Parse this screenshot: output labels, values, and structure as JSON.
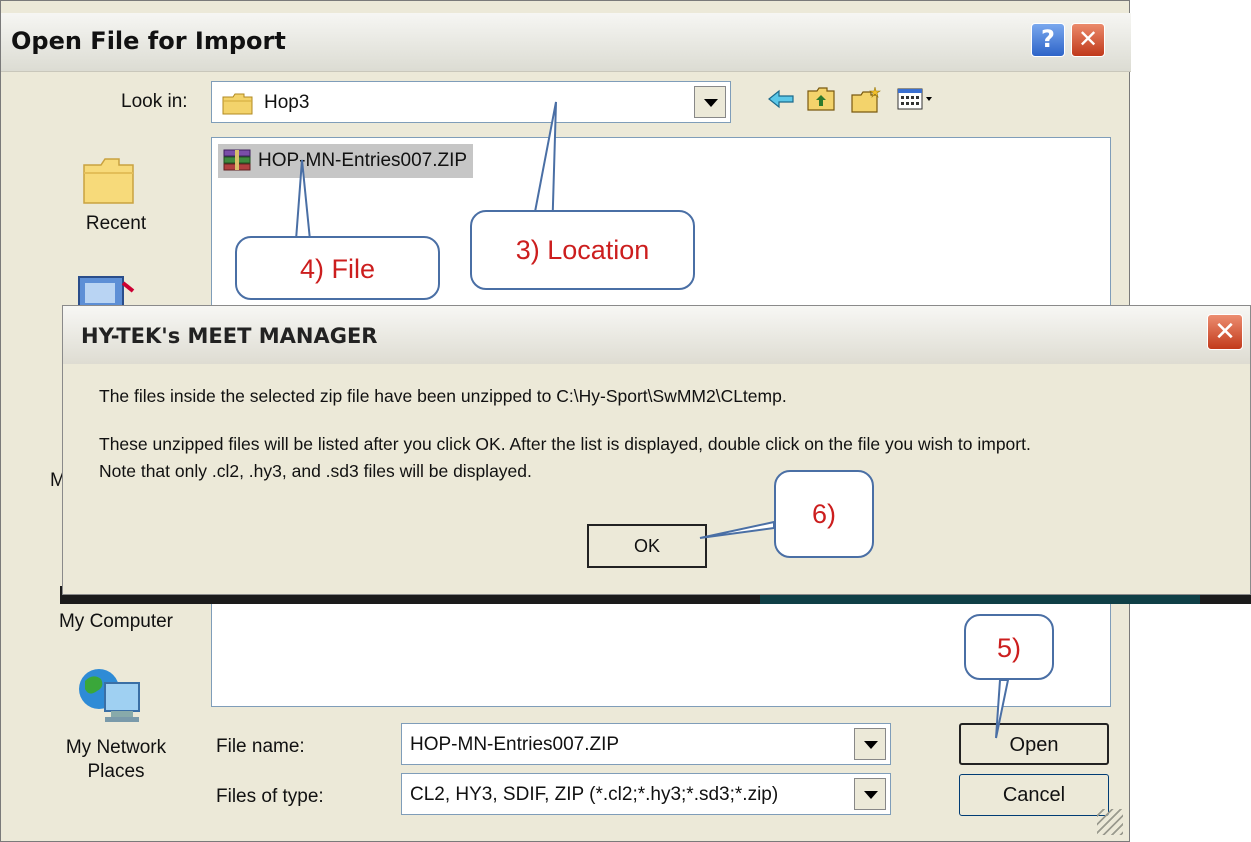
{
  "open_dialog": {
    "title": "Open File for Import",
    "help_button": "?",
    "close_button": "✕",
    "look_in_label": "Look in:",
    "look_in_value": "Hop3",
    "places": {
      "recent": "Recent",
      "my_computer": "My Computer",
      "my_network_places_line1": "My Network",
      "my_network_places_line2": "Places",
      "my_fragment": "My"
    },
    "files": [
      {
        "name": "HOP-MN-Entries007.ZIP"
      }
    ],
    "file_name_label": "File name:",
    "file_name_value": "HOP-MN-Entries007.ZIP",
    "files_of_type_label": "Files of type:",
    "files_of_type_value": "CL2, HY3, SDIF, ZIP (*.cl2;*.hy3;*.sd3;*.zip)",
    "open_button": "Open",
    "cancel_button": "Cancel"
  },
  "message_dialog": {
    "title": "HY-TEK's MEET MANAGER",
    "close_button": "✕",
    "line1": "The files inside the selected zip file have been unzipped to C:\\Hy-Sport\\SwMM2\\CLtemp.",
    "line2": "These unzipped files will be listed after you click OK.  After the list is displayed, double click on the file you wish to import.",
    "line3": "Note that only .cl2, .hy3, and .sd3 files will be displayed.",
    "ok_button": "OK"
  },
  "callouts": {
    "location": "3) Location",
    "file": "4) File",
    "open": "5)",
    "ok": "6)"
  },
  "colors": {
    "dialog_bg": "#ece9d8",
    "callout_text": "#cc1e1e",
    "callout_border": "#4a6fa5",
    "close_red": "#c23a1b"
  }
}
